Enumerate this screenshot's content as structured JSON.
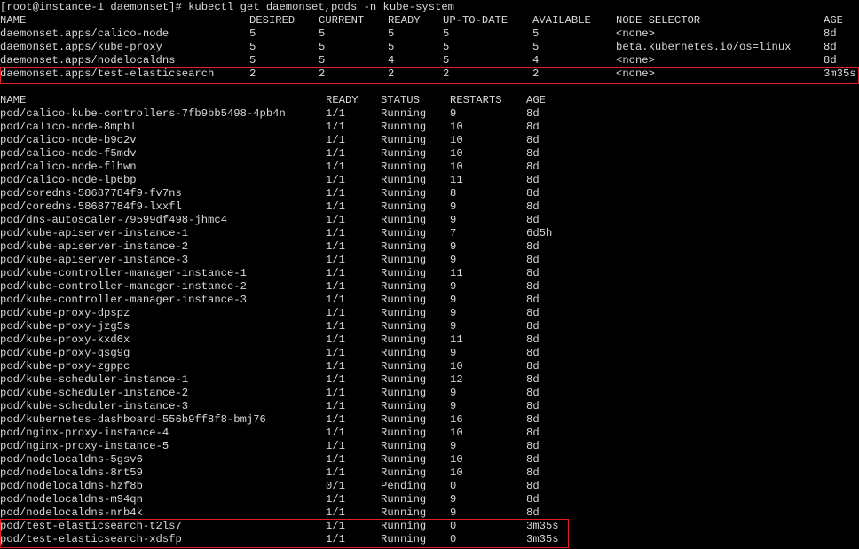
{
  "terminal": {
    "prompt": "[root@instance-1 daemonset]# kubectl get daemonset,pods -n kube-system",
    "colors": {
      "background": "#000000",
      "text": "#d8d8d8",
      "highlight_border": "#e02020"
    },
    "daemonsets": {
      "headers": [
        "NAME",
        "DESIRED",
        "CURRENT",
        "READY",
        "UP-TO-DATE",
        "AVAILABLE",
        "NODE SELECTOR",
        "AGE"
      ],
      "rows": [
        [
          "daemonset.apps/calico-node",
          "5",
          "5",
          "5",
          "5",
          "5",
          "<none>",
          "8d"
        ],
        [
          "daemonset.apps/kube-proxy",
          "5",
          "5",
          "5",
          "5",
          "5",
          "beta.kubernetes.io/os=linux",
          "8d"
        ],
        [
          "daemonset.apps/nodelocaldns",
          "5",
          "5",
          "4",
          "5",
          "4",
          "<none>",
          "8d"
        ],
        [
          "daemonset.apps/test-elasticsearch",
          "2",
          "2",
          "2",
          "2",
          "2",
          "<none>",
          "3m35s"
        ]
      ]
    },
    "pods": {
      "headers": [
        "NAME",
        "READY",
        "STATUS",
        "RESTARTS",
        "AGE"
      ],
      "rows": [
        [
          "pod/calico-kube-controllers-7fb9bb5498-4pb4n",
          "1/1",
          "Running",
          "9",
          "8d"
        ],
        [
          "pod/calico-node-8mpbl",
          "1/1",
          "Running",
          "10",
          "8d"
        ],
        [
          "pod/calico-node-b9c2v",
          "1/1",
          "Running",
          "10",
          "8d"
        ],
        [
          "pod/calico-node-f5mdv",
          "1/1",
          "Running",
          "10",
          "8d"
        ],
        [
          "pod/calico-node-flhwn",
          "1/1",
          "Running",
          "10",
          "8d"
        ],
        [
          "pod/calico-node-lp6bp",
          "1/1",
          "Running",
          "11",
          "8d"
        ],
        [
          "pod/coredns-58687784f9-fv7ns",
          "1/1",
          "Running",
          "8",
          "8d"
        ],
        [
          "pod/coredns-58687784f9-lxxfl",
          "1/1",
          "Running",
          "9",
          "8d"
        ],
        [
          "pod/dns-autoscaler-79599df498-jhmc4",
          "1/1",
          "Running",
          "9",
          "8d"
        ],
        [
          "pod/kube-apiserver-instance-1",
          "1/1",
          "Running",
          "7",
          "6d5h"
        ],
        [
          "pod/kube-apiserver-instance-2",
          "1/1",
          "Running",
          "9",
          "8d"
        ],
        [
          "pod/kube-apiserver-instance-3",
          "1/1",
          "Running",
          "9",
          "8d"
        ],
        [
          "pod/kube-controller-manager-instance-1",
          "1/1",
          "Running",
          "11",
          "8d"
        ],
        [
          "pod/kube-controller-manager-instance-2",
          "1/1",
          "Running",
          "9",
          "8d"
        ],
        [
          "pod/kube-controller-manager-instance-3",
          "1/1",
          "Running",
          "9",
          "8d"
        ],
        [
          "pod/kube-proxy-dpspz",
          "1/1",
          "Running",
          "9",
          "8d"
        ],
        [
          "pod/kube-proxy-jzg5s",
          "1/1",
          "Running",
          "9",
          "8d"
        ],
        [
          "pod/kube-proxy-kxd6x",
          "1/1",
          "Running",
          "11",
          "8d"
        ],
        [
          "pod/kube-proxy-qsg9g",
          "1/1",
          "Running",
          "9",
          "8d"
        ],
        [
          "pod/kube-proxy-zgppc",
          "1/1",
          "Running",
          "10",
          "8d"
        ],
        [
          "pod/kube-scheduler-instance-1",
          "1/1",
          "Running",
          "12",
          "8d"
        ],
        [
          "pod/kube-scheduler-instance-2",
          "1/1",
          "Running",
          "9",
          "8d"
        ],
        [
          "pod/kube-scheduler-instance-3",
          "1/1",
          "Running",
          "9",
          "8d"
        ],
        [
          "pod/kubernetes-dashboard-556b9ff8f8-bmj76",
          "1/1",
          "Running",
          "16",
          "8d"
        ],
        [
          "pod/nginx-proxy-instance-4",
          "1/1",
          "Running",
          "10",
          "8d"
        ],
        [
          "pod/nginx-proxy-instance-5",
          "1/1",
          "Running",
          "9",
          "8d"
        ],
        [
          "pod/nodelocaldns-5gsv6",
          "1/1",
          "Running",
          "10",
          "8d"
        ],
        [
          "pod/nodelocaldns-8rt59",
          "1/1",
          "Running",
          "10",
          "8d"
        ],
        [
          "pod/nodelocaldns-hzf8b",
          "0/1",
          "Pending",
          "0",
          "8d"
        ],
        [
          "pod/nodelocaldns-m94qn",
          "1/1",
          "Running",
          "9",
          "8d"
        ],
        [
          "pod/nodelocaldns-nrb4k",
          "1/1",
          "Running",
          "9",
          "8d"
        ],
        [
          "pod/test-elasticsearch-t2ls7",
          "1/1",
          "Running",
          "0",
          "3m35s"
        ],
        [
          "pod/test-elasticsearch-xdsfp",
          "1/1",
          "Running",
          "0",
          "3m35s"
        ]
      ]
    }
  }
}
